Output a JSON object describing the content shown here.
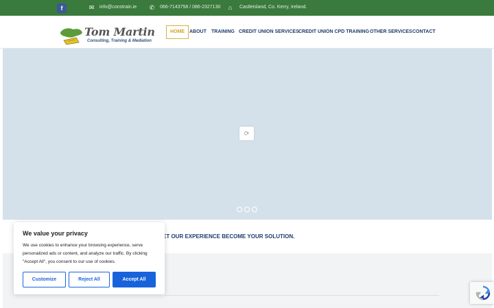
{
  "topbar": {
    "facebook_glyph": "f",
    "email": "info@constrain.ie",
    "phone": "066-7143758 / 086-2327130",
    "address": "Castleisland, Co. Kerry, Ireland."
  },
  "logo": {
    "title": "Tom Martin",
    "tagline": "Consulting, Training & Mediation"
  },
  "nav": {
    "items": [
      {
        "label": "HOME",
        "active": true
      },
      {
        "label": "ABOUT"
      },
      {
        "label": "TRAINING"
      },
      {
        "label": "CREDIT UNION SERVICES"
      },
      {
        "label": "CREDIT UNION CPD TRAINING"
      },
      {
        "label": "OTHER SERVICES"
      },
      {
        "label": "CONTACT"
      }
    ]
  },
  "slider": {
    "dots": 3
  },
  "tagline": "ET OUR EXPERIENCE BECOME YOUR SOLUTION.",
  "cookie": {
    "title": "We value your privacy",
    "body": "We use cookies to enhance your browsing experience, serve personalized ads or content, and analyze our traffic. By clicking \"Accept All\", you consent to our use of cookies.",
    "customize": "Customize",
    "reject": "Reject All",
    "accept": "Accept All"
  },
  "colors": {
    "topbar": "#3a7a3c",
    "nav_text": "#1f3d6b",
    "nav_active": "#d6a31c",
    "slider_bg": "#d4e1ea",
    "cookie_accent": "#1863dc"
  }
}
